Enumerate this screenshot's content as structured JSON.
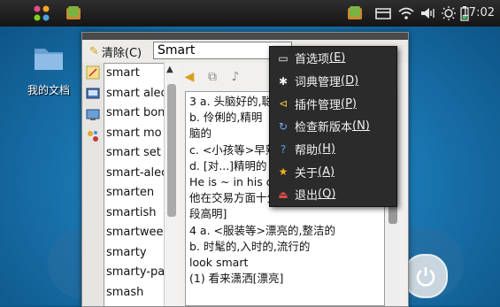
{
  "topbar": {
    "clock": "17:02"
  },
  "desktop": {
    "documents_label": "我的文档"
  },
  "window": {
    "clear_label": "清除(C)",
    "search_value": "Smart"
  },
  "word_list": [
    "smart",
    "smart alec",
    "smart bon",
    "smart mo",
    "smart set",
    "smart-alec",
    "smarten",
    "smartish",
    "smartwee",
    "smarty",
    "smarty-pa",
    "smash"
  ],
  "definition_lines": [
    "3 a. 头脑好的,聪",
    "b. 伶俐的,精明",
    "脑的",
    "c. <小孩等>早熟",
    "d. [对...]精明的",
    "He is ~ in his d",
    "他在交易方面十分精明 [经营手",
    "段高明]",
    "4 a. <服装等>漂亮的,整洁的",
    "b. 时髦的,入时的,流行的",
    "look smart",
    "(1) 看来潇洒[漂亮]"
  ],
  "menu": {
    "items": [
      {
        "text": "首选项",
        "key": "(E)",
        "icon": "preferences-icon"
      },
      {
        "text": "词典管理",
        "key": "(D)",
        "icon": "dictionary-manager-icon"
      },
      {
        "text": "插件管理",
        "key": "(P)",
        "icon": "plugin-manager-icon"
      },
      {
        "text": "检查新版本",
        "key": "(N)",
        "icon": "check-update-icon"
      },
      {
        "text": "帮助",
        "key": "(H)",
        "icon": "help-icon"
      },
      {
        "text": "关于",
        "key": "(A)",
        "icon": "about-star-icon"
      },
      {
        "text": "退出",
        "key": "(Q)",
        "icon": "quit-icon"
      }
    ]
  }
}
